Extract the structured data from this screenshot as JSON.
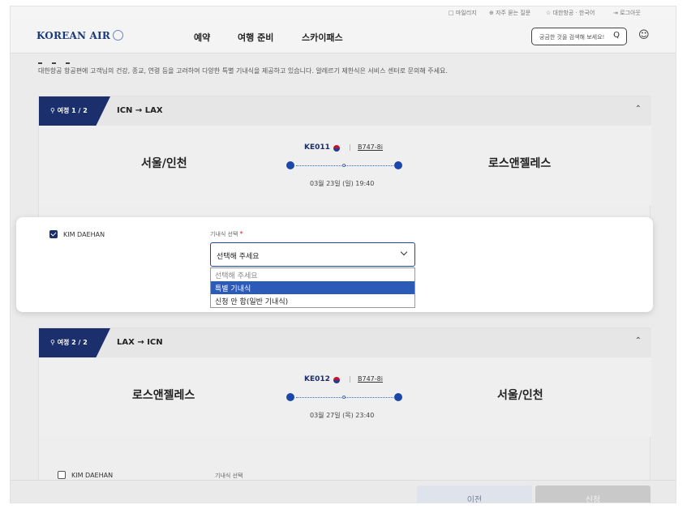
{
  "topbar": {
    "items": [
      "□ 마일리지",
      "⊕ 자주 묻는 질문",
      "☆ 대한항공 · 한국어",
      "⇥ 로그아웃"
    ]
  },
  "header": {
    "logo": "KOREAN AIR",
    "nav": [
      "예약",
      "여행 준비",
      "스카이패스"
    ],
    "search_placeholder": "궁금한 것을 검색해 보세요!",
    "search_icon": "Q",
    "my_icon": "MY"
  },
  "intro_text": "대한항공 항공편에 고객님의 건강, 종교, 연령 등을 고려하여 다양한 특별 기내식을 제공하고 있습니다. 알레르기 제한식은 서비스 센터로 문의해 주세요.",
  "trips": [
    {
      "tag": "여정 1 / 2",
      "route_from": "ICN",
      "route_arrow": "→",
      "route_to": "LAX",
      "flight_no": "KE011",
      "aircraft": "B747-8i",
      "origin": "서울/인천",
      "destination": "로스앤젤레스",
      "datetime": "03월 23일 (일) 19:40"
    },
    {
      "tag": "여정 2 / 2",
      "route_from": "LAX",
      "route_arrow": "→",
      "route_to": "ICN",
      "flight_no": "KE012",
      "aircraft": "B747-8i",
      "origin": "로스앤젤레스",
      "destination": "서울/인천",
      "datetime": "03월 27일 (목) 23:40"
    }
  ],
  "passenger": {
    "name": "KIM DAEHAN",
    "field_label": "기내식 선택",
    "required_mark": "*",
    "selected": "선택해 주세요",
    "options": [
      "선택해 주세요",
      "특별 기내식",
      "신청 안 함(일반 기내식)"
    ],
    "highlighted_option": "특별 기내식"
  },
  "passenger2": {
    "name": "KIM DAEHAN",
    "field_label": "기내식 선택"
  },
  "footer": {
    "prev_label": "이전",
    "next_label": "신청"
  },
  "colors": {
    "brand_navy": "#1a2f6b",
    "accent_blue": "#1a47a8",
    "highlight": "#2b5ab8",
    "required": "#d0102a"
  }
}
